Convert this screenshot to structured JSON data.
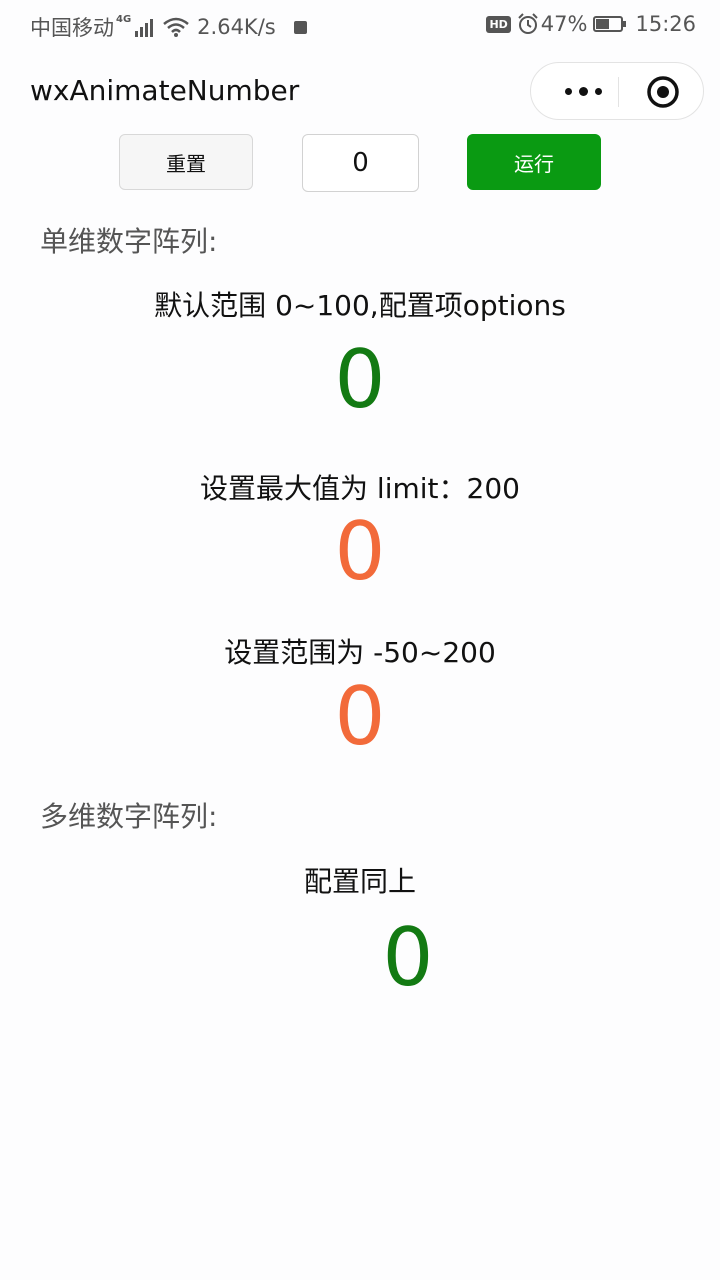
{
  "status_bar": {
    "carrier": "中国移动",
    "network_type": "4G",
    "speed": "2.64K/s",
    "hd": "HD",
    "battery": "47%",
    "time": "15:26"
  },
  "nav": {
    "title": "wxAnimateNumber"
  },
  "controls": {
    "reset_label": "重置",
    "input_value": "0",
    "run_label": "运行"
  },
  "single": {
    "section_label": "单维数字阵列:",
    "items": [
      {
        "caption": "默认范围 0~100,配置项options",
        "value": "0",
        "color": "#137a13"
      },
      {
        "caption": "设置最大值为 limit：200",
        "value": "0",
        "color": "#f26a3a"
      },
      {
        "caption": "设置范围为 -50~200",
        "value": "0",
        "color": "#f26a3a"
      }
    ]
  },
  "multi": {
    "section_label": "多维数字阵列:",
    "caption": "配置同上",
    "value": "0",
    "color": "#137a13"
  }
}
